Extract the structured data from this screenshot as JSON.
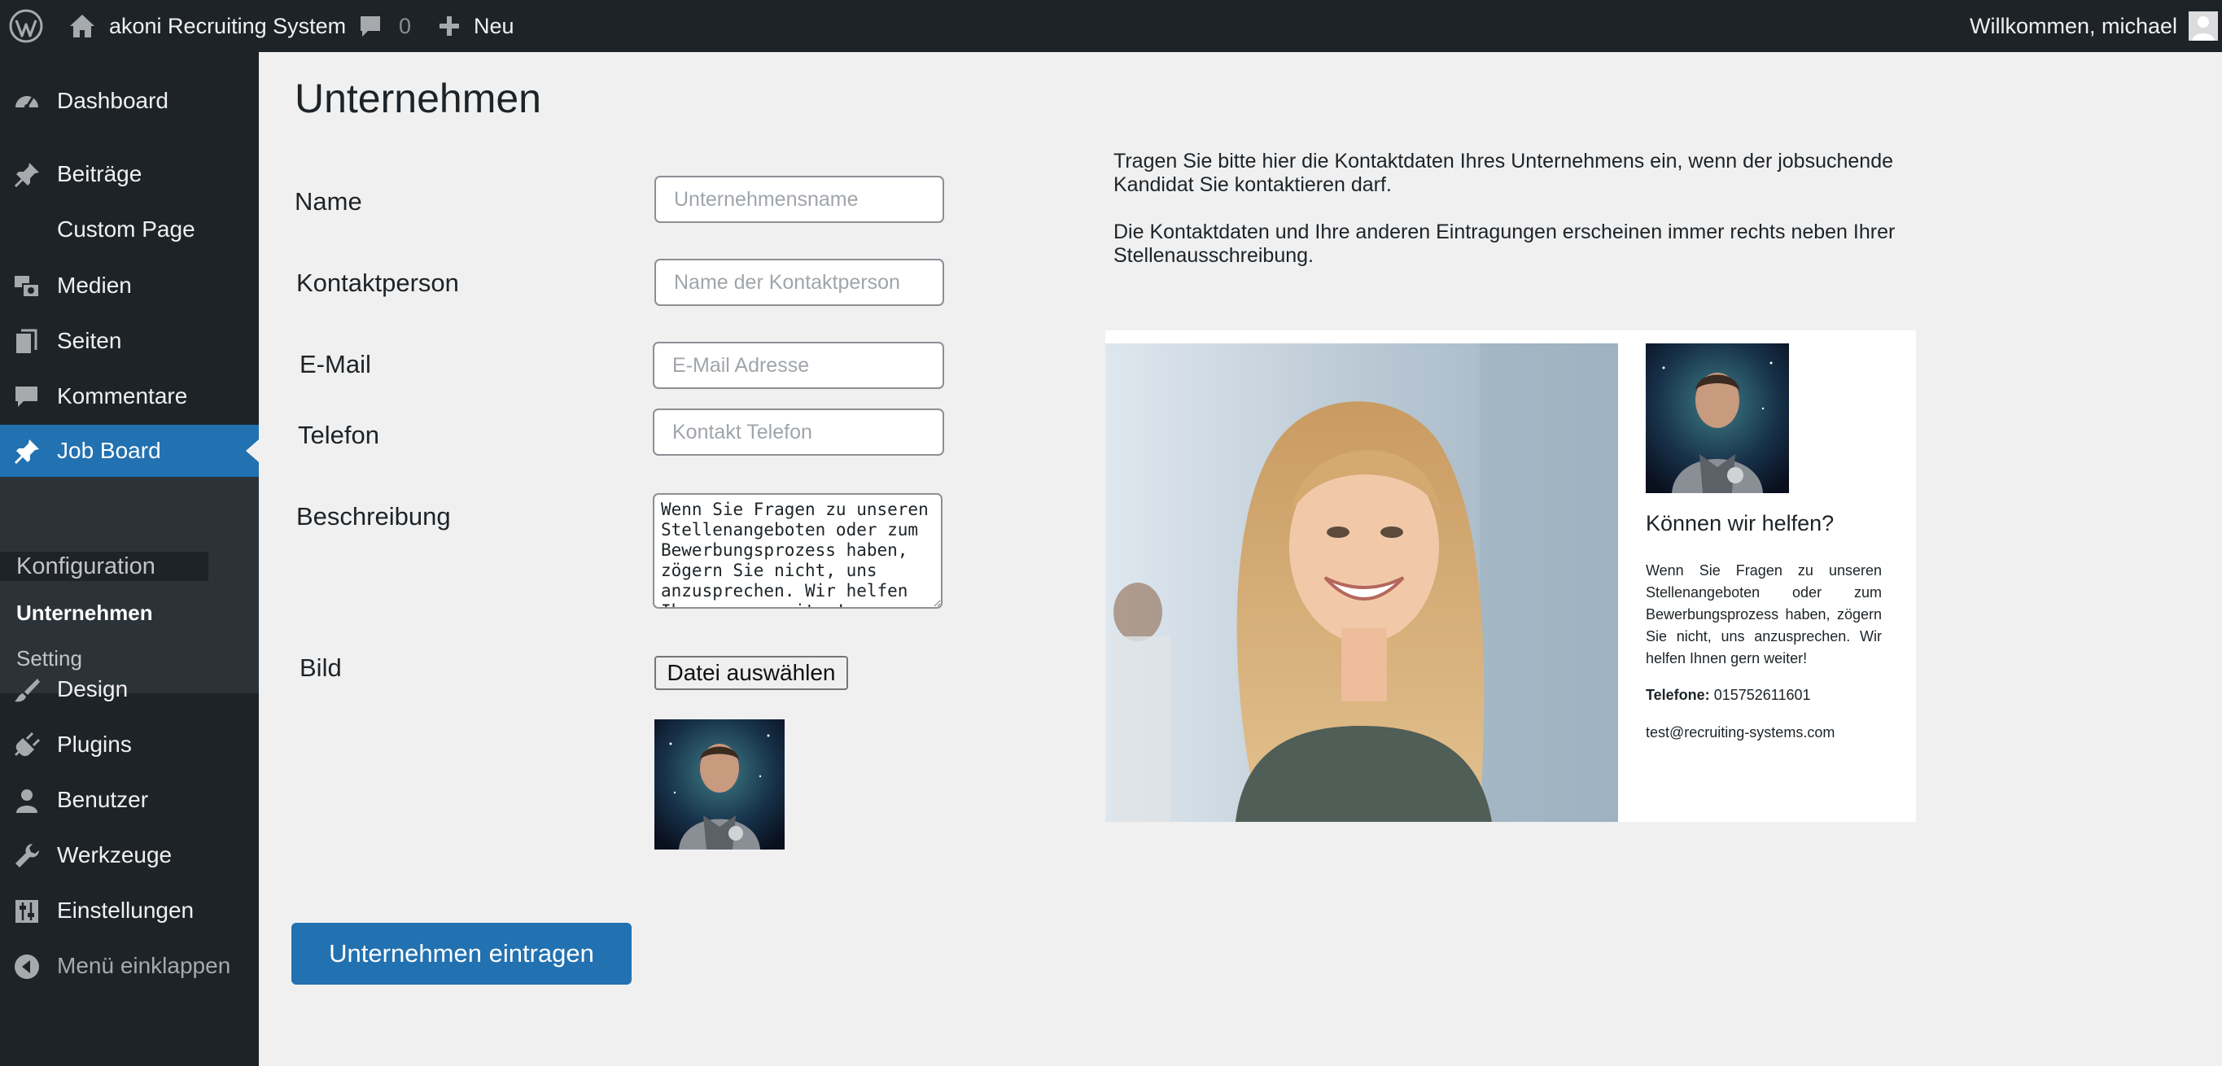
{
  "adminbar": {
    "site_name": "akoni Recruiting System",
    "comments_count": "0",
    "new_label": "Neu",
    "greeting": "Willkommen, michael"
  },
  "sidebar": {
    "items": [
      {
        "label": "Dashboard",
        "icon": "dashboard-icon"
      },
      {
        "label": "Beiträge",
        "icon": "pin-icon"
      },
      {
        "label": "Custom Page",
        "icon": ""
      },
      {
        "label": "Medien",
        "icon": "media-icon"
      },
      {
        "label": "Seiten",
        "icon": "pages-icon"
      },
      {
        "label": "Kommentare",
        "icon": "comment-icon"
      },
      {
        "label": "Job Board",
        "icon": "pin-icon"
      },
      {
        "label": "Design",
        "icon": "brush-icon"
      },
      {
        "label": "Plugins",
        "icon": "plug-icon"
      },
      {
        "label": "Benutzer",
        "icon": "user-icon"
      },
      {
        "label": "Werkzeuge",
        "icon": "wrench-icon"
      },
      {
        "label": "Einstellungen",
        "icon": "settings-icon"
      },
      {
        "label": "Menü einklappen",
        "icon": "collapse-icon"
      }
    ],
    "submenu": {
      "header": "Konfiguration",
      "items": [
        "Unternehmen",
        "Setting"
      ]
    }
  },
  "main": {
    "title": "Unternehmen",
    "form": {
      "name_label": "Name",
      "name_placeholder": "Unternehmensname",
      "contact_label": "Kontaktperson",
      "contact_placeholder": "Name der Kontaktperson",
      "email_label": "E-Mail",
      "email_placeholder": "E-Mail Adresse",
      "phone_label": "Telefon",
      "phone_placeholder": "Kontakt Telefon",
      "description_label": "Beschreibung",
      "description_value": "Wenn Sie Fragen zu unseren Stellenangeboten oder zum Bewerbungsprozess haben, zögern Sie nicht, uns anzusprechen. Wir helfen Ihnen gern weiter!",
      "image_label": "Bild",
      "file_button": "Datei auswählen",
      "submit_label": "Unternehmen eintragen"
    },
    "info": {
      "paragraph1": "Tragen Sie bitte hier die Kontaktdaten Ihres Unternehmens ein, wenn der jobsuchende Kandidat Sie kontaktieren darf.",
      "paragraph2": "Die Kontaktdaten und Ihre anderen Eintragungen erscheinen immer rechts neben Ihrer Stellenausschreibung."
    },
    "preview": {
      "heading": "Können wir helfen?",
      "description": "Wenn Sie Fragen zu unseren Stellenangeboten oder zum Bewerbungsprozess haben, zögern Sie nicht, uns anzusprechen. Wir helfen Ihnen gern weiter!",
      "phone_label": "Telefone:",
      "phone_value": "015752611601",
      "email": "test@recruiting-systems.com"
    }
  },
  "colors": {
    "admin_bg": "#1d2327",
    "accent": "#2271b1",
    "page_bg": "#f0f0f1",
    "submenu_bg": "#2c3338"
  }
}
